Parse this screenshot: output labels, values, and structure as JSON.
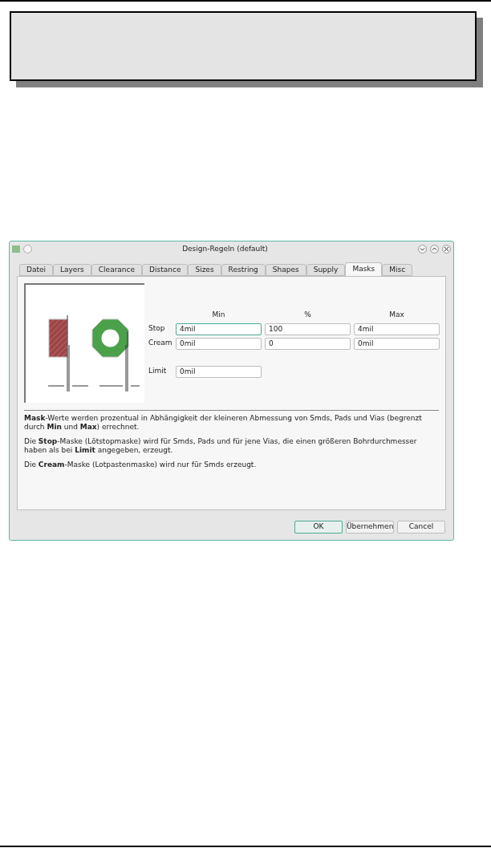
{
  "window": {
    "title": "Design-Regeln (default)"
  },
  "tabs": [
    {
      "label": "Datei",
      "selected": false
    },
    {
      "label": "Layers",
      "selected": false
    },
    {
      "label": "Clearance",
      "selected": false
    },
    {
      "label": "Distance",
      "selected": false
    },
    {
      "label": "Sizes",
      "selected": false
    },
    {
      "label": "Restring",
      "selected": false
    },
    {
      "label": "Shapes",
      "selected": false
    },
    {
      "label": "Supply",
      "selected": false
    },
    {
      "label": "Masks",
      "selected": true
    },
    {
      "label": "Misc",
      "selected": false
    }
  ],
  "columns": [
    "Min",
    "%",
    "Max"
  ],
  "rows": [
    {
      "label": "Stop",
      "fields": [
        {
          "value": "4mil",
          "focused": true
        },
        {
          "value": "100",
          "focused": false
        },
        {
          "value": "4mil",
          "focused": false
        }
      ]
    },
    {
      "label": "Cream",
      "fields": [
        {
          "value": "0mil",
          "focused": false
        },
        {
          "value": "0",
          "focused": false
        },
        {
          "value": "0mil",
          "focused": false
        }
      ]
    }
  ],
  "limit": {
    "label": "Limit",
    "value": "0mil"
  },
  "description": [
    "**Mask**-Werte werden prozentual in Abhängigkeit der kleineren Abmessung von Smds, Pads und Vias (begrenzt durch **Min** und **Max**) errechnet.",
    "Die **Stop**-Maske (Lötstopmaske) wird für Smds, Pads und für jene Vias, die einen größeren Bohrdurchmesser haben als bei **Limit** angegeben, erzeugt.",
    "Die **Cream**-Maske (Lotpastenmaske) wird nur für Smds erzeugt."
  ],
  "buttons": [
    {
      "label": "OK",
      "default": true
    },
    {
      "label": "Übernehmen",
      "default": false
    },
    {
      "label": "Cancel",
      "default": false
    }
  ]
}
